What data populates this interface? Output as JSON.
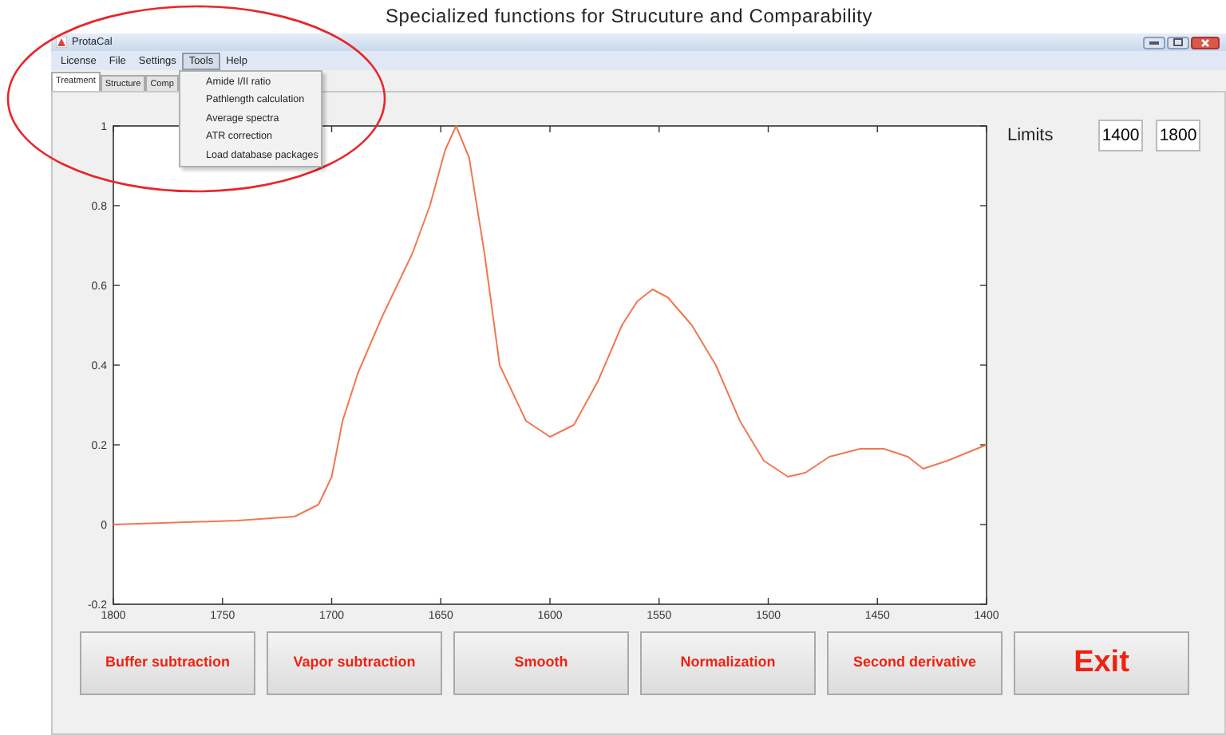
{
  "caption": "Specialized functions for Strucuture and Comparability",
  "window": {
    "title": "ProtaCal"
  },
  "menu": [
    {
      "label": "License",
      "selected": false
    },
    {
      "label": "File",
      "selected": false
    },
    {
      "label": "Settings",
      "selected": false
    },
    {
      "label": "Tools",
      "selected": true
    },
    {
      "label": "Help",
      "selected": false
    }
  ],
  "tools_menu": [
    "Amide I/II ratio",
    "Pathlength calculation",
    "Average spectra",
    "ATR correction",
    "Load database packages"
  ],
  "tabs": [
    {
      "label": "Treatment",
      "selected": true
    },
    {
      "label": "Structure",
      "selected": false
    },
    {
      "label": "Comp",
      "selected": false
    }
  ],
  "chart_data": {
    "type": "line",
    "xlim": [
      1800,
      1400
    ],
    "ylim": [
      -0.2,
      1
    ],
    "xticks": [
      1800,
      1750,
      1700,
      1650,
      1600,
      1550,
      1500,
      1450,
      1400
    ],
    "yticks": [
      -0.2,
      0,
      0.2,
      0.4,
      0.6,
      0.8,
      1
    ],
    "x": [
      1800,
      1743,
      1717,
      1706,
      1700,
      1695,
      1688,
      1677,
      1663,
      1655,
      1648,
      1643,
      1637,
      1630,
      1623,
      1611,
      1600,
      1589,
      1578,
      1567,
      1560,
      1553,
      1546,
      1535,
      1524,
      1513,
      1502,
      1491,
      1483,
      1472,
      1458,
      1447,
      1436,
      1429,
      1418,
      1400
    ],
    "series": [
      {
        "color": "#f07850",
        "values": [
          0,
          0.01,
          0.02,
          0.05,
          0.12,
          0.26,
          0.38,
          0.52,
          0.68,
          0.8,
          0.94,
          1,
          0.92,
          0.68,
          0.4,
          0.26,
          0.22,
          0.25,
          0.36,
          0.5,
          0.56,
          0.59,
          0.57,
          0.5,
          0.4,
          0.26,
          0.16,
          0.12,
          0.13,
          0.17,
          0.19,
          0.19,
          0.17,
          0.14,
          0.16,
          0.2
        ]
      }
    ]
  },
  "limits": {
    "label": "Limits",
    "values": [
      "1400",
      "1800"
    ]
  },
  "buttons": [
    {
      "label": "Buffer subtraction",
      "kind": "normal"
    },
    {
      "label": "Vapor subtraction",
      "kind": "normal"
    },
    {
      "label": "Smooth",
      "kind": "normal"
    },
    {
      "label": "Normalization",
      "kind": "normal"
    },
    {
      "label": "Second derivative",
      "kind": "normal"
    },
    {
      "label": "Exit",
      "kind": "exit"
    }
  ],
  "highlight": {
    "kind": "ellipse",
    "color": "#e8262a"
  }
}
